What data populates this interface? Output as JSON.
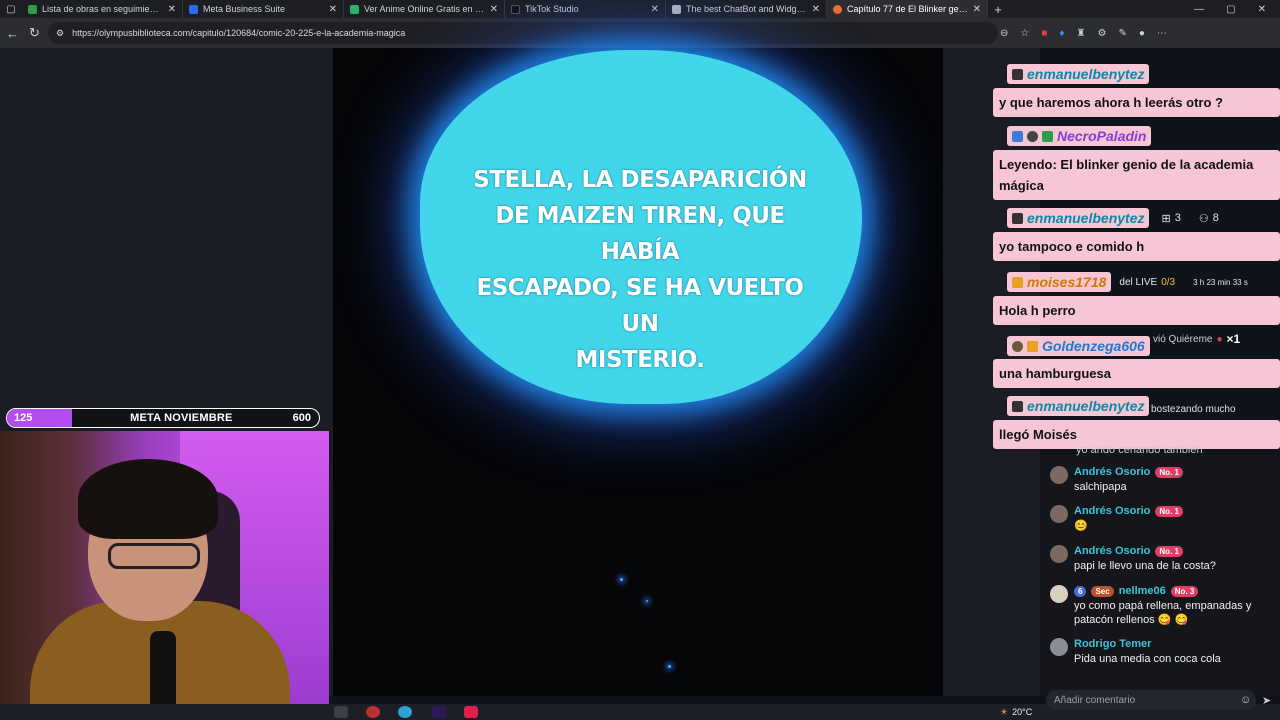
{
  "browser": {
    "tabs": [
      {
        "title": "Lista de obras en seguimiento - l",
        "color": "#2e9e48"
      },
      {
        "title": "Meta Business Suite",
        "color": "#2c6df0"
      },
      {
        "title": "Ver Anime Online Gratis en HD y",
        "color": "#28b36c"
      },
      {
        "title": "TikTok Studio",
        "color": "#111111"
      },
      {
        "title": "The best ChatBot and Widgets fo",
        "color": "#bbbbbb"
      },
      {
        "title": "Capítulo 77 de El Blinker genio d",
        "color": "#e8703a"
      }
    ],
    "url": "https://olympusbiblioteca.com/capitulo/120684/comic-20-225-e-la-academia-magica"
  },
  "comic": {
    "bubble_lines": [
      "STELLA, LA DESAPARICIÓN",
      "DE MAIZEN TIREN, QUE HABÍA",
      "ESCAPADO, SE HA VUELTO UN",
      "MISTERIO."
    ],
    "bubble_color": "#42d6ea"
  },
  "goal": {
    "current": "125",
    "title": "META NOVIEMBRE",
    "target": "600",
    "progress_fraction": 0.208
  },
  "overlay_chat": [
    {
      "user": "enmanuelbenytez",
      "message": "y que haremos ahora h leerás otro ?",
      "name_color": "#0b8aa8"
    },
    {
      "user": "NecroPaladin",
      "message": "Leyendo: El blinker genio de la academia mágica",
      "name_color": "#8a3ad8"
    },
    {
      "user": "enmanuelbenytez",
      "message": "yo tampoco e comido h",
      "name_color": "#0b8aa8"
    },
    {
      "user": "moises1718",
      "message": "Hola h perro",
      "name_color": "#d07a00"
    },
    {
      "user": "Goldenzega606",
      "message": "una hamburguesa",
      "name_color": "#1a7ad0"
    },
    {
      "user": "enmanuelbenytez",
      "message": "llegó Moisés",
      "name_color": "#0b8aa8"
    }
  ],
  "overlay_extras": {
    "gift_count": "3",
    "user_count": "8",
    "live_label": "del LIVE",
    "live_progress": "0/3",
    "live_time": "3 h 23 min 33 s",
    "gift_text": "vió Quiéreme",
    "gift_mult": "×1",
    "partial_text": "bostezando mucho",
    "partial_text2": "yo ando cenando también"
  },
  "tiktok_chat": [
    {
      "user": "Andrés Osorio",
      "badge": "No. 1",
      "text": "salchipapa"
    },
    {
      "user": "Andrés Osorio",
      "badge": "No. 1",
      "text": "😊"
    },
    {
      "user": "Andrés Osorio",
      "badge": "No. 1",
      "text": "papi le llevo una de la costa?"
    },
    {
      "user": "nellme06",
      "badge": "No. 3",
      "text": "yo como papá rellena, empanadas y patacón rellenos 😋 😋",
      "pre": [
        "6",
        "Sec"
      ]
    },
    {
      "user": "Rodrigo Temer",
      "badge": "",
      "text": "Pida una media con coca cola"
    }
  ],
  "comment_placeholder": "Añadir comentario",
  "weather": "20°C"
}
